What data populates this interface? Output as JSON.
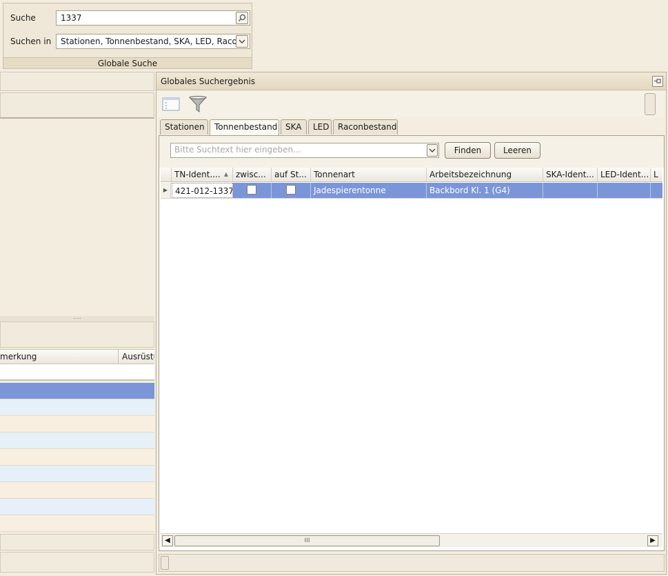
{
  "global_search": {
    "search_label": "Suche",
    "search_value": "1337",
    "search_in_label": "Suchen in",
    "search_in_value": "Stationen, Tonnenbestand, SKA, LED, Raco…",
    "footer_label": "Globale Suche"
  },
  "left_panel": {
    "columns": [
      "merkung",
      "Ausrüstu"
    ],
    "splitter_grip": "....",
    "row_colors": [
      "#7b96d8",
      "#e6f0f8",
      "#f8efe0",
      "#e6f0f8",
      "#f8efe0",
      "#e6f0f8",
      "#f8efe0",
      "#e6f0f8",
      "#f8efe0"
    ]
  },
  "result_panel": {
    "title": "Globales Suchergebnis",
    "tabs": [
      {
        "label": "Stationen",
        "active": false
      },
      {
        "label": "Tonnenbestand",
        "active": true
      },
      {
        "label": "SKA",
        "active": false
      },
      {
        "label": "LED",
        "active": false
      },
      {
        "label": "Raconbestand",
        "active": false
      }
    ],
    "filter_placeholder": "Bitte Suchtext hier eingeben...",
    "find_button": "Finden",
    "clear_button": "Leeren",
    "table": {
      "columns": [
        "TN-Ident....",
        "zwisc...",
        "auf St...",
        "Tonnenart",
        "Arbeitsbezeichnung",
        "SKA-Ident...",
        "LED-Ident...",
        "L"
      ],
      "sort_column": "TN-Ident....",
      "rows": [
        {
          "tn_ident": "421-012-1337",
          "zwisc": false,
          "auf_st": false,
          "tonnenart": "Jadespierentonne",
          "arbeitsbezeichnung": "Backbord Kl. 1 (G4)",
          "ska_ident": "",
          "led_ident": ""
        }
      ]
    },
    "scroll_grip": "III"
  },
  "colors": {
    "selection": "#7b96d8",
    "panel_bg": "#f3ede0"
  }
}
